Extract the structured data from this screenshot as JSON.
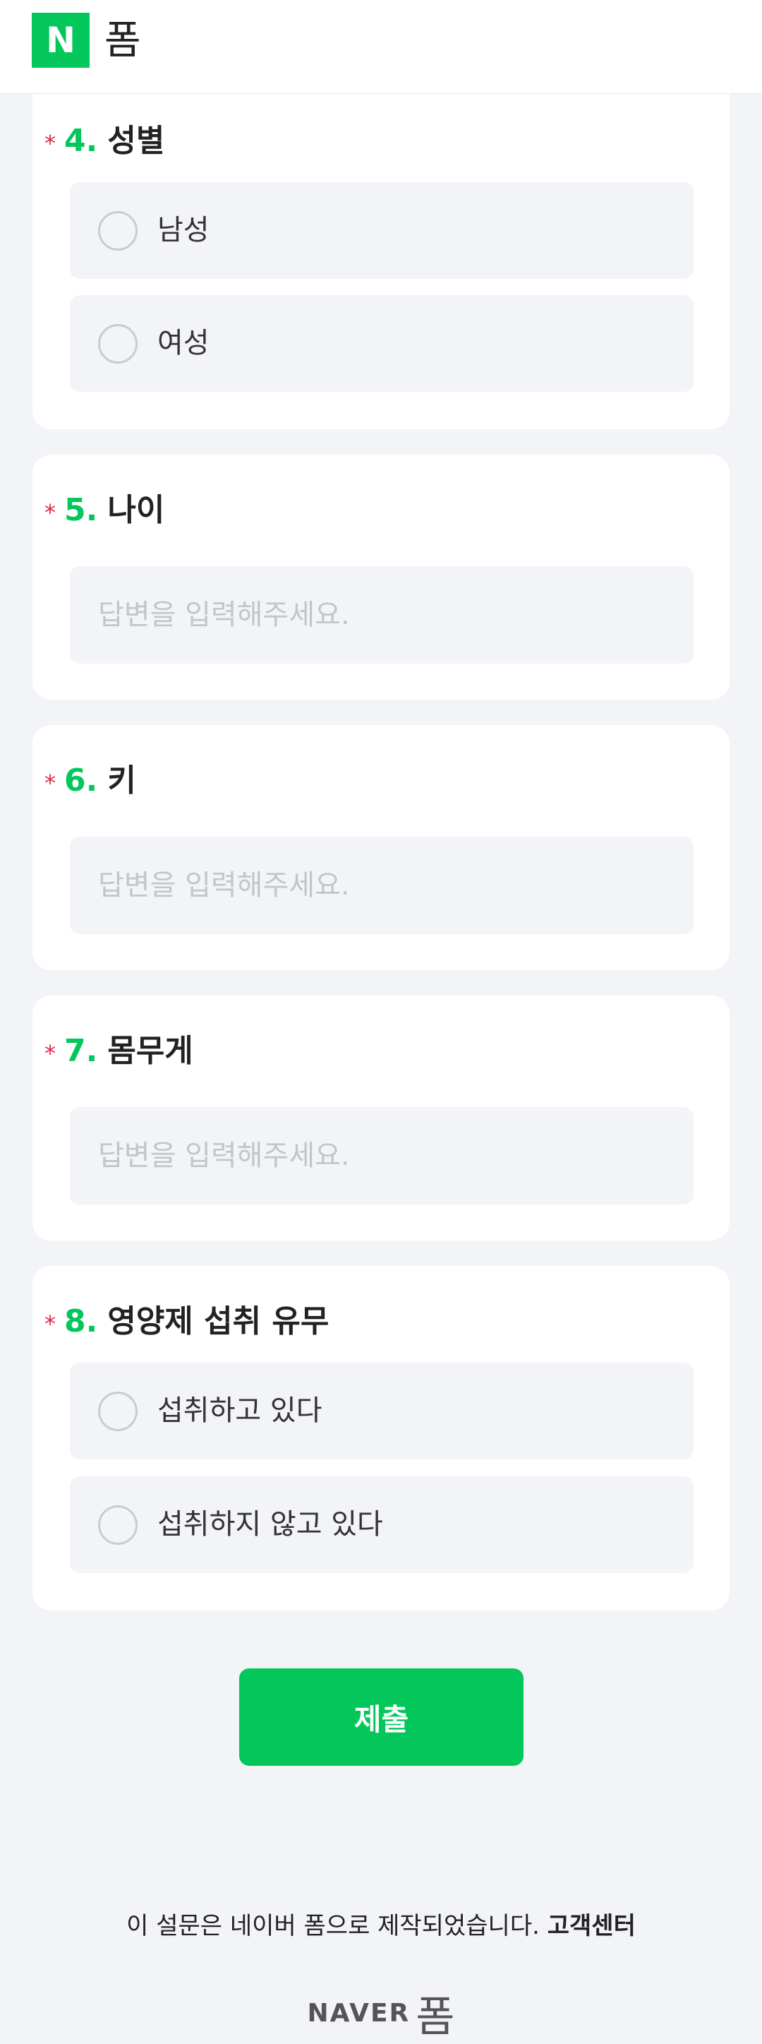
{
  "header": {
    "logo_letter": "N",
    "title": "폼"
  },
  "questions": [
    {
      "star": "*",
      "number": "4.",
      "title": "성별",
      "options": [
        "남성",
        "여성"
      ]
    },
    {
      "star": "*",
      "number": "5.",
      "title": "나이",
      "placeholder": "답변을 입력해주세요."
    },
    {
      "star": "*",
      "number": "6.",
      "title": "키",
      "placeholder": "답변을 입력해주세요."
    },
    {
      "star": "*",
      "number": "7.",
      "title": "몸무게",
      "placeholder": "답변을 입력해주세요."
    },
    {
      "star": "*",
      "number": "8.",
      "title": "영양제 섭취 유무",
      "options": [
        "섭취하고 있다",
        "섭취하지 않고 있다"
      ]
    }
  ],
  "submit_label": "제출",
  "footer": {
    "text": "이 설문은 네이버 폼으로 제작되었습니다.",
    "link": "고객센터",
    "brand_naver": "NAVER",
    "brand_form": "폼"
  },
  "colors": {
    "accent": "#03c75a",
    "required": "#e0284f",
    "background": "#f3f4f8"
  }
}
